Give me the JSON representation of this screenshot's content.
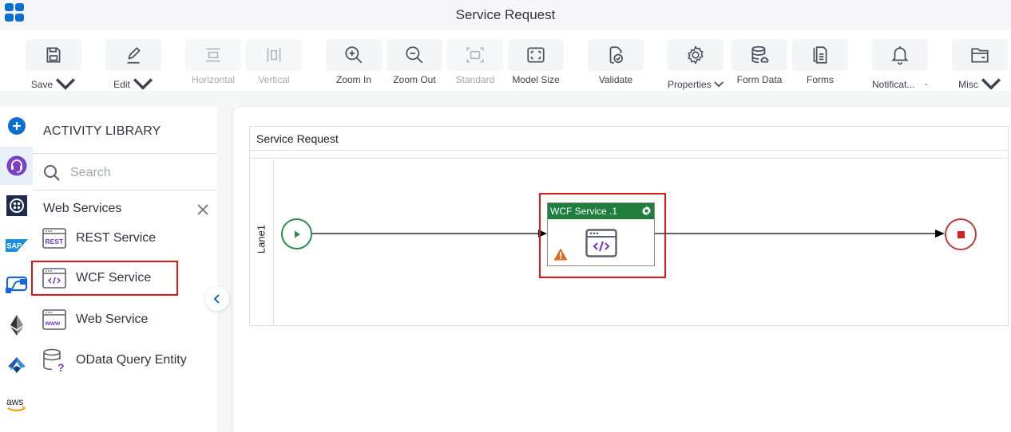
{
  "header": {
    "title": "Service Request",
    "apps_icon": "apps-grid-icon"
  },
  "toolbar": {
    "items": [
      {
        "label": "Save",
        "icon": "save-icon",
        "has_dropdown": true,
        "enabled": true
      },
      {
        "label": "Edit",
        "icon": "edit-icon",
        "has_dropdown": true,
        "enabled": true
      },
      {
        "label": "Horizontal",
        "icon": "horizontal-icon",
        "has_dropdown": false,
        "enabled": false
      },
      {
        "label": "Vertical",
        "icon": "vertical-icon",
        "has_dropdown": false,
        "enabled": false
      },
      {
        "label": "Zoom In",
        "icon": "zoom-in-icon",
        "has_dropdown": false,
        "enabled": true
      },
      {
        "label": "Zoom Out",
        "icon": "zoom-out-icon",
        "has_dropdown": false,
        "enabled": true
      },
      {
        "label": "Standard",
        "icon": "standard-icon",
        "has_dropdown": false,
        "enabled": false
      },
      {
        "label": "Model Size",
        "icon": "model-size-icon",
        "has_dropdown": false,
        "enabled": true
      },
      {
        "label": "Validate",
        "icon": "validate-icon",
        "has_dropdown": false,
        "enabled": true
      },
      {
        "label": "Properties",
        "icon": "gear-icon",
        "has_dropdown": true,
        "enabled": true
      },
      {
        "label": "Form Data",
        "icon": "database-icon",
        "has_dropdown": false,
        "enabled": true
      },
      {
        "label": "Forms",
        "icon": "forms-icon",
        "has_dropdown": false,
        "enabled": true
      },
      {
        "label": "Notificat...",
        "icon": "bell-icon",
        "has_dropdown": true,
        "enabled": true
      },
      {
        "label": "Misc",
        "icon": "folder-icon",
        "has_dropdown": true,
        "enabled": true
      }
    ]
  },
  "left_rail": {
    "items": [
      {
        "name": "add",
        "icon": "add-icon",
        "active": false
      },
      {
        "name": "support",
        "icon": "headset-icon",
        "active": true
      },
      {
        "name": "twilio",
        "icon": "twilio-icon",
        "active": false
      },
      {
        "name": "sap",
        "icon": "sap-icon",
        "active": false
      },
      {
        "name": "power-automate",
        "icon": "power-automate-icon",
        "active": false
      },
      {
        "name": "ethereum",
        "icon": "ethereum-icon",
        "active": false
      },
      {
        "name": "azure",
        "icon": "azure-icon",
        "active": false
      },
      {
        "name": "aws",
        "icon": "aws-icon",
        "active": false
      }
    ]
  },
  "library": {
    "title": "ACTIVITY LIBRARY",
    "search_placeholder": "Search",
    "category": "Web Services",
    "items": [
      {
        "label": "REST Service",
        "icon": "rest-service-icon",
        "highlighted": false
      },
      {
        "label": "WCF Service",
        "icon": "wcf-service-icon",
        "highlighted": true
      },
      {
        "label": "Web Service",
        "icon": "web-service-icon",
        "highlighted": false
      },
      {
        "label": "OData Query Entity",
        "icon": "odata-query-icon",
        "highlighted": false
      }
    ]
  },
  "canvas": {
    "pool_name": "Service Request",
    "lane_name": "Lane1",
    "task": {
      "title": "WCF Service .1",
      "has_warning": true
    },
    "colors": {
      "task_header": "#1e7e3e",
      "start_event": "#2e8b4a",
      "end_event": "#c0393b",
      "highlight": "#e01515"
    }
  }
}
